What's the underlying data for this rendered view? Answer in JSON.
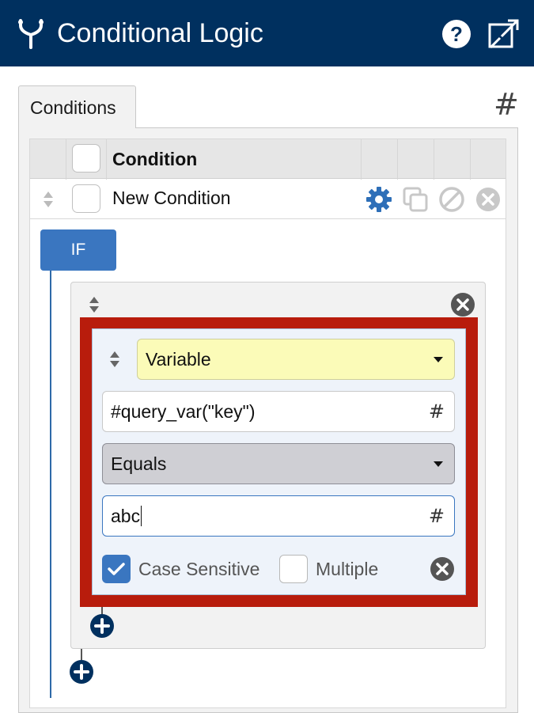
{
  "header": {
    "title": "Conditional Logic",
    "title_icon": "fork-icon",
    "help_icon": "help-icon",
    "expand_icon": "expand-icon",
    "background": "#00305f"
  },
  "tabs": [
    {
      "label": "Conditions",
      "active": true
    }
  ],
  "hash_button": "#",
  "table": {
    "header": {
      "column_label": "Condition"
    },
    "rows": [
      {
        "name": "New Condition",
        "actions": [
          "settings-icon",
          "duplicate-icon",
          "disable-icon",
          "delete-icon"
        ]
      }
    ]
  },
  "logic": {
    "if_label": "IF",
    "rule": {
      "source_select": "Variable",
      "expression": "#query_var(\"key\")",
      "expression_hash": "#",
      "operator_select": "Equals",
      "value": "abc",
      "value_hash": "#",
      "case_sensitive": {
        "label": "Case Sensitive",
        "checked": true
      },
      "multiple": {
        "label": "Multiple",
        "checked": false
      }
    }
  },
  "colors": {
    "accent": "#3a76c0",
    "highlight_frame": "#b81c0c",
    "variable_field": "#fbfbb8"
  }
}
